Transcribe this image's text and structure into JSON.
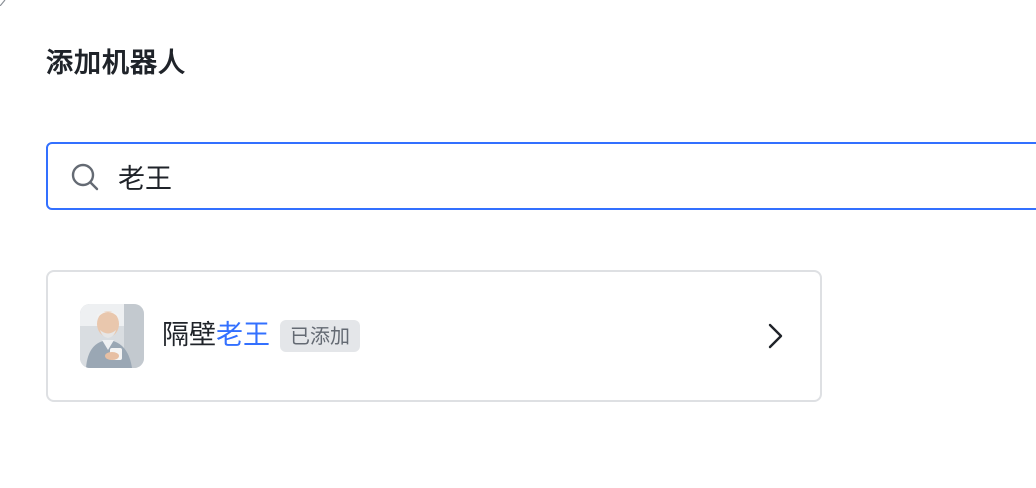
{
  "dialog": {
    "title": "添加机器人"
  },
  "search": {
    "value": "老王",
    "icon": "search-icon"
  },
  "results": [
    {
      "name_prefix": "隔壁",
      "name_match": "老王",
      "badge": "已添加",
      "avatar": "avatar-photo",
      "action_icon": "chevron-right-icon"
    }
  ],
  "colors": {
    "accent": "#3370ff",
    "text": "#1f2329",
    "muted": "#646a73",
    "border": "#dee0e3",
    "badge_bg": "#e4e6e9"
  }
}
